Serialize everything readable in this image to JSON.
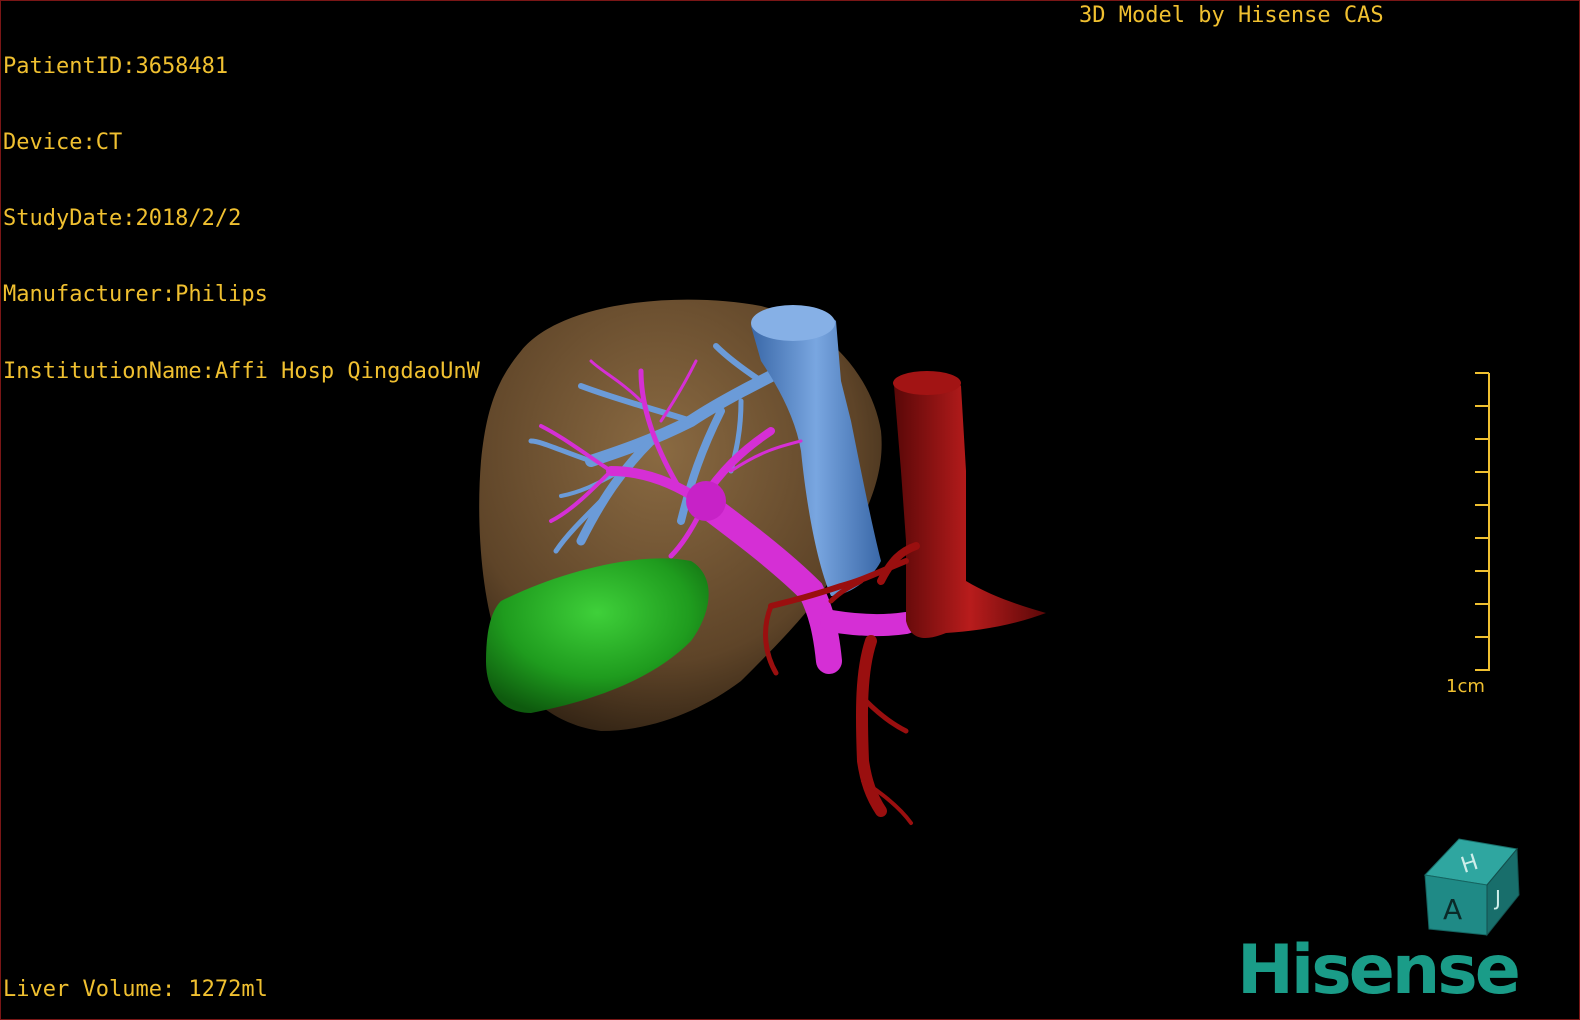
{
  "overlay": {
    "patient_id": "PatientID:3658481",
    "device": "Device:CT",
    "study_date": "StudyDate:2018/2/2",
    "manufacturer": "Manufacturer:Philips",
    "institution": "InstitutionName:Affi Hosp QingdaoUnW",
    "vendor_title": "3D Model by Hisense CAS",
    "liver_volume": "Liver Volume: 1272ml"
  },
  "scale": {
    "label": "1cm"
  },
  "orientation_cube": {
    "top_letter": "H",
    "front_letter": "A",
    "side_letter": "J"
  },
  "brand": {
    "logo_text": "Hisense"
  },
  "colors": {
    "liver": "#6b5131",
    "gallbladder": "#1f9c1e",
    "hepatic_vein": "#5e8fd0",
    "portal_vein": "#d629d6",
    "artery": "#9a0f0f",
    "overlay_text": "#f0c030",
    "brand": "#1a9c88"
  }
}
